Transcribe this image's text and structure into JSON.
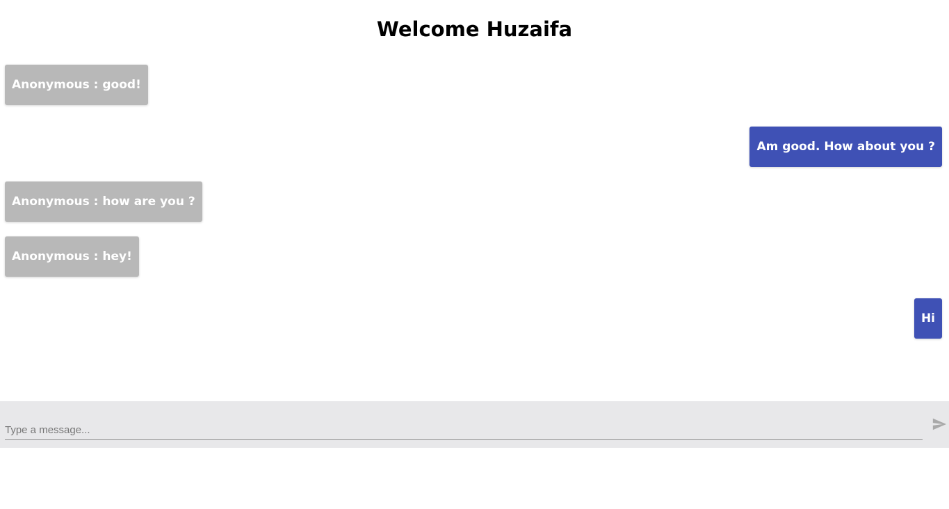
{
  "header": {
    "title": "Welcome Huzaifa"
  },
  "messages": [
    {
      "direction": "incoming",
      "text": "Anonymous : good!"
    },
    {
      "direction": "outgoing",
      "text": "Am good. How about you ?"
    },
    {
      "direction": "incoming",
      "text": "Anonymous : how are you ?"
    },
    {
      "direction": "incoming",
      "text": "Anonymous : hey!"
    },
    {
      "direction": "outgoing",
      "text": "Hi"
    }
  ],
  "composer": {
    "placeholder": "Type a message...",
    "value": "",
    "send_icon": "send-icon"
  },
  "colors": {
    "incoming_bubble": "#b8b8b8",
    "outgoing_bubble": "#3f51b5",
    "composer_bg": "#e8e8ea",
    "send_icon": "#a9a9a9"
  }
}
